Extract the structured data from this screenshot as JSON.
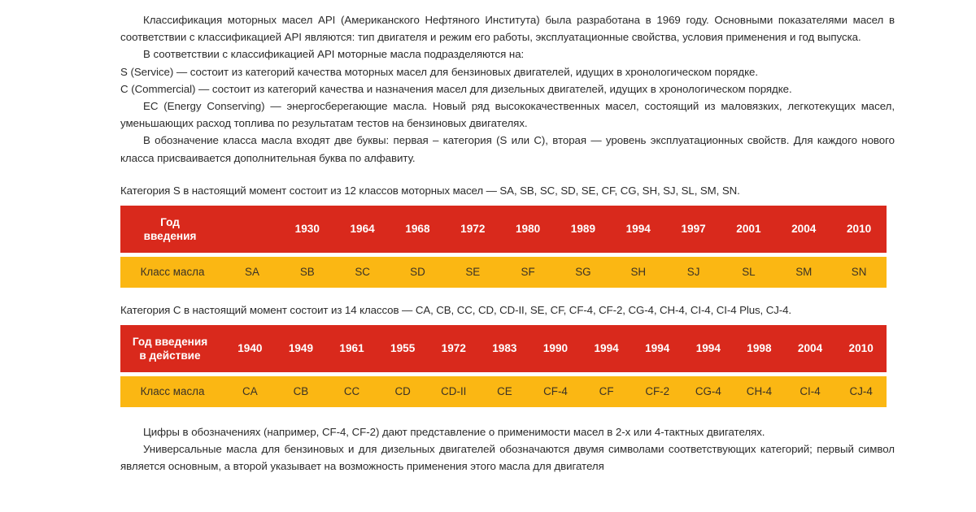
{
  "document": {
    "paragraphs": [
      "Классификация моторных масел API (Американского Нефтяного Института) была разработана в 1969 году. Основными показателями масел в соответствии с классификацией API являются: тип двигателя и режим его работы, эксплуатационные свойства, условия применения и год выпуска.",
      "В соответствии с классификацией API моторные масла подразделяются на:",
      "S (Service) — состоит из категорий качества моторных масел для бензиновых двигателей, идущих в хронологическом порядке.",
      "C (Commercial) — состоит из категорий качества и назначения масел для дизельных двигателей, идущих в хронологическом порядке.",
      "EC (Energy Conserving) — энергосберегающие масла. Новый ряд высококачественных масел, состоящий из маловязких, легкотекущих масел, уменьшающих расход топлива по результатам тестов на бензиновых двигателях.",
      "В обозначение класса масла входят две буквы: первая – категория (S или C), вторая — уровень эксплуатационных свойств. Для каждого нового класса присваивается дополнительная буква по алфавиту."
    ],
    "footer_paragraphs": [
      "Цифры в обозначениях (например, CF-4, CF-2) дают представление о применимости масел в 2-х или 4-тактных двигателях.",
      "Универсальные масла для бензиновых и для дизельных двигателей обозначаются двумя символами соответствующих категорий; первый символ является основным, а второй указывает на возможность применения этого масла для двигателя"
    ]
  },
  "table_s": {
    "caption": "Категория S в настоящий момент состоит из 12 классов моторных масел — SA, SB, SC, SD, SE, CF, CG, SH, SJ, SL, SM, SN.",
    "header_label": "Год\nвведения",
    "header_label_line1": "Год",
    "header_label_line2": "введения",
    "body_label": "Класс масла",
    "years": [
      "1930",
      "1964",
      "1968",
      "1972",
      "1980",
      "1989",
      "1994",
      "1997",
      "2001",
      "2004",
      "2010"
    ],
    "classes": [
      "SA",
      "SB",
      "SC",
      "SD",
      "SE",
      "SF",
      "SG",
      "SH",
      "SJ",
      "SL",
      "SM",
      "SN"
    ]
  },
  "table_c": {
    "caption": "Категория C в настоящий момент состоит из 14 классов — CA, CB, CC, CD, CD-II, SE, CF, CF-4, CF-2, CG-4, CH-4, CI-4, CI-4 Plus, CJ-4.",
    "header_label_line1": "Год введения",
    "header_label_line2": "в действие",
    "body_label": "Класс масла",
    "years": [
      "1940",
      "1949",
      "1961",
      "1955",
      "1972",
      "1983",
      "1990",
      "1994",
      "1994",
      "1994",
      "1998",
      "2004",
      "2010"
    ],
    "classes": [
      "CA",
      "CB",
      "CC",
      "CD",
      "CD-II",
      "CE",
      "CF-4",
      "CF",
      "CF-2",
      "CG-4",
      "CH-4",
      "CI-4",
      "CJ-4"
    ]
  },
  "colors": {
    "header_red": "#d9291c",
    "body_yellow": "#fbb713",
    "text": "#2b2b2b",
    "header_text": "#ffffff",
    "page_background": "#ffffff"
  }
}
